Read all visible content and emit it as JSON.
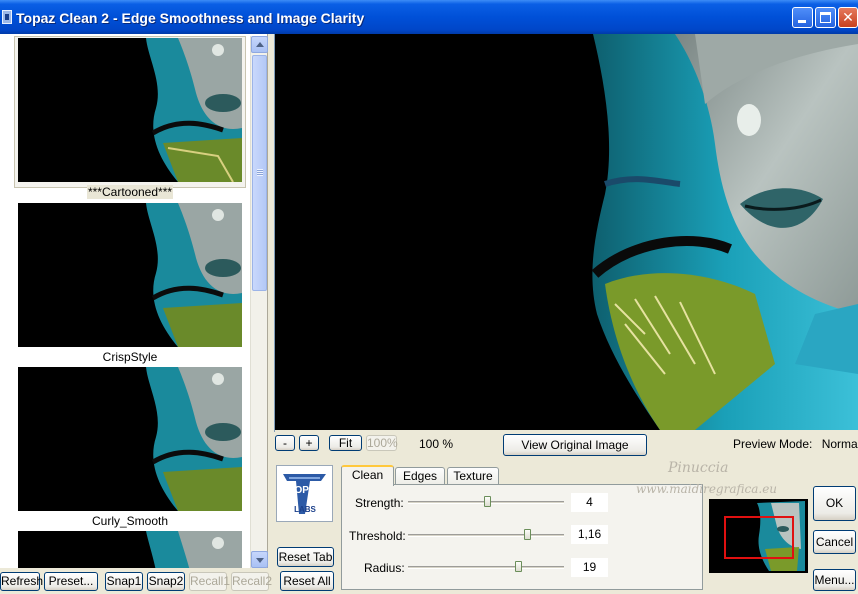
{
  "window": {
    "title": "Topaz Clean 2 - Edge Smoothness and Image Clarity"
  },
  "presets": [
    {
      "label": "***Cartooned***",
      "selected": true
    },
    {
      "label": "CrispStyle",
      "selected": false
    },
    {
      "label": "Curly_Smooth",
      "selected": false
    }
  ],
  "bottom_buttons": {
    "refresh": "Refresh",
    "preset": "Preset...",
    "snap1": "Snap1",
    "snap2": "Snap2",
    "recall1": "Recall1",
    "recall2": "Recall2",
    "reset_tab": "Reset Tab",
    "reset_all": "Reset All"
  },
  "zoom": {
    "minus": "-",
    "plus": "+",
    "fit": "Fit",
    "hundred": "100%",
    "level": "100 %"
  },
  "view_original_label": "View Original Image",
  "preview_mode": {
    "label": "Preview Mode:",
    "value": "Normal"
  },
  "tabs": [
    "Clean",
    "Edges",
    "Texture"
  ],
  "active_tab": "Clean",
  "params": [
    {
      "label": "Strength:",
      "value": "4",
      "slider_fraction": 0.5
    },
    {
      "label": "Threshold:",
      "value": "1,16",
      "slider_fraction": 0.78
    },
    {
      "label": "Radius:",
      "value": "19",
      "slider_fraction": 0.71
    }
  ],
  "watermark": {
    "line1": "Pinuccia",
    "line2": "www.maidiregrafica.eu"
  },
  "logo": {
    "text1": "TOPAZ",
    "text2": "LABS"
  },
  "dialog_buttons": {
    "ok": "OK",
    "cancel": "Cancel",
    "menu": "Menu..."
  },
  "colors": {
    "navigator_frame": "#e01010",
    "title_bar": "#0050d8"
  }
}
